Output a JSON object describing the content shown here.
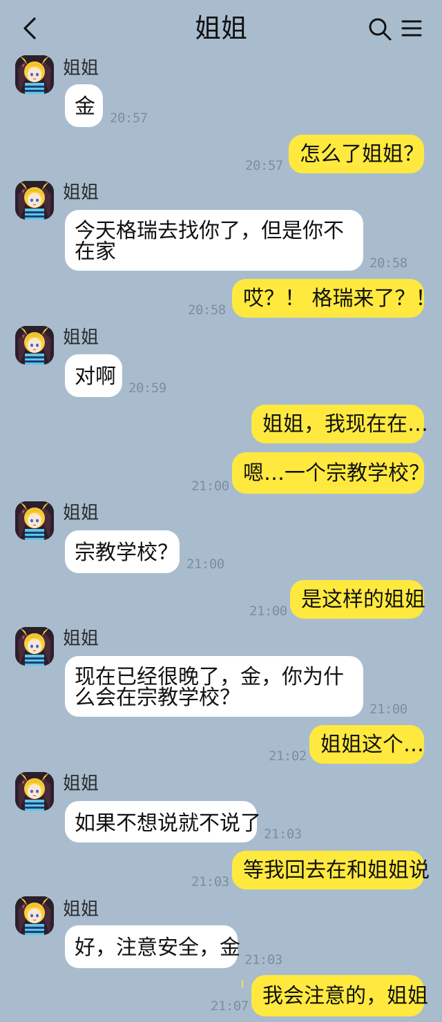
{
  "header": {
    "title": "姐姐",
    "back_icon": "chevron-left-icon",
    "search_icon": "search-icon",
    "menu_icon": "hamburger-menu-icon"
  },
  "contact": {
    "name": "姐姐"
  },
  "messages": [
    {
      "side": "in",
      "text": "金",
      "time": "20:57"
    },
    {
      "side": "out",
      "text": "怎么了姐姐？",
      "time": "20:57"
    },
    {
      "side": "in",
      "text": "今天格瑞去找你了，但是你不在家",
      "time": "20:58"
    },
    {
      "side": "out",
      "text": "哎？！ 格瑞来了？！",
      "time": "20:58"
    },
    {
      "side": "in",
      "text": "对啊",
      "time": "20:59"
    },
    {
      "side": "out",
      "text": "姐姐，我现在在…",
      "time": ""
    },
    {
      "side": "out",
      "text": "嗯…一个宗教学校？",
      "time": "21:00"
    },
    {
      "side": "in",
      "text": "宗教学校？",
      "time": "21:00"
    },
    {
      "side": "out",
      "text": "是这样的姐姐",
      "time": "21:00"
    },
    {
      "side": "in",
      "text": "现在已经很晚了，金，你为什么会在宗教学校？",
      "time": "21:00"
    },
    {
      "side": "out",
      "text": "姐姐这个…",
      "time": "21:02"
    },
    {
      "side": "in",
      "text": "如果不想说就不说了",
      "time": "21:03"
    },
    {
      "side": "out",
      "text": "等我回去在和姐姐说",
      "time": "21:03"
    },
    {
      "side": "in",
      "text": "好，注意安全，金",
      "time": "21:03"
    },
    {
      "side": "out",
      "text": "我会注意的，姐姐",
      "time": "21:07"
    }
  ],
  "colors": {
    "background": "#a9bcce",
    "incoming_bubble": "#ffffff",
    "outgoing_bubble": "#ffe93f",
    "timestamp": "#7d8da0"
  }
}
